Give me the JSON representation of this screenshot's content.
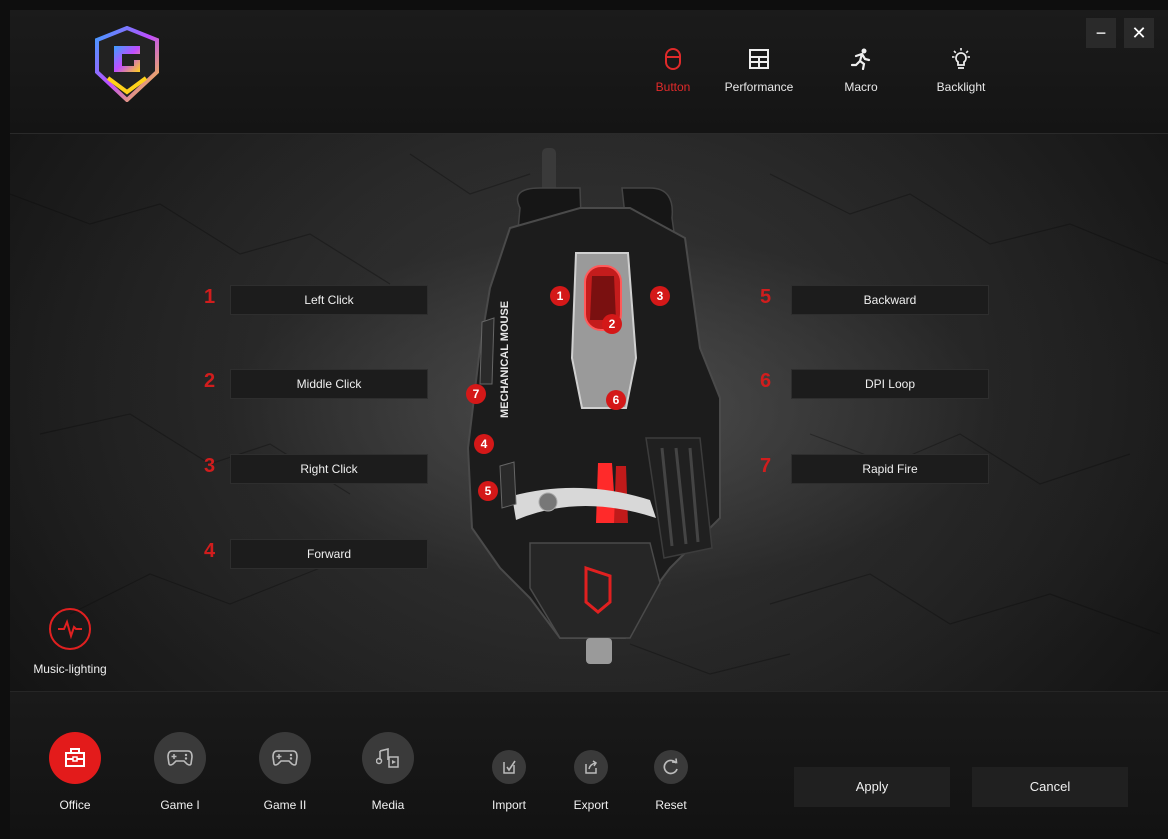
{
  "header": {
    "nav": [
      {
        "label": "Button",
        "icon": "mouse-icon",
        "active": true
      },
      {
        "label": "Performance",
        "icon": "grid-icon",
        "active": false
      },
      {
        "label": "Macro",
        "icon": "running-man-icon",
        "active": false
      },
      {
        "label": "Backlight",
        "icon": "lightbulb-icon",
        "active": false
      }
    ],
    "minimize": "−",
    "close": "✕"
  },
  "buttons_left": [
    {
      "num": "1",
      "label": "Left Click"
    },
    {
      "num": "2",
      "label": "Middle Click"
    },
    {
      "num": "3",
      "label": "Right Click"
    },
    {
      "num": "4",
      "label": "Forward"
    }
  ],
  "buttons_right": [
    {
      "num": "5",
      "label": "Backward"
    },
    {
      "num": "6",
      "label": "DPI Loop"
    },
    {
      "num": "7",
      "label": "Rapid Fire"
    }
  ],
  "mouse": {
    "side_text": "MECHANICAL MOUSE",
    "markers": [
      "1",
      "2",
      "3",
      "4",
      "5",
      "6",
      "7"
    ]
  },
  "music_lighting": {
    "label": "Music-lighting"
  },
  "profiles": [
    {
      "label": "Office",
      "icon": "briefcase-icon",
      "active": true
    },
    {
      "label": "Game I",
      "icon": "gamepad-icon",
      "active": false
    },
    {
      "label": "Game II",
      "icon": "gamepad-icon",
      "active": false
    },
    {
      "label": "Media",
      "icon": "music-note-icon",
      "active": false
    }
  ],
  "tools": [
    {
      "label": "Import",
      "icon": "import-icon"
    },
    {
      "label": "Export",
      "icon": "export-icon"
    },
    {
      "label": "Reset",
      "icon": "reset-icon"
    }
  ],
  "actions": {
    "apply": "Apply",
    "cancel": "Cancel"
  },
  "colors": {
    "accent": "#e31b1b",
    "background": "#1a1a1a",
    "panel": "#202020"
  }
}
